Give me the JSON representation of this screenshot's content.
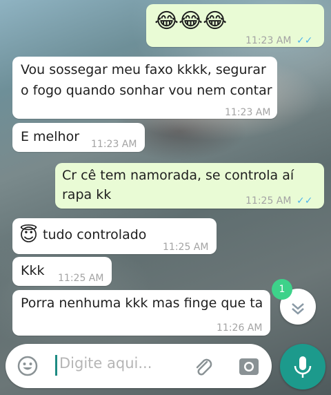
{
  "chat": {
    "messages": [
      {
        "direction": "out",
        "text": "😂😂😂",
        "time": "11:23 AM",
        "ticks": "✓✓"
      },
      {
        "direction": "in",
        "text_line1": "Vou sossegar meu faxo kkkk, segurar",
        "text_line2": "o fogo quando sonhar vou nem contar",
        "time": "11:23 AM"
      },
      {
        "direction": "in",
        "text": "E melhor",
        "time": "11:23 AM"
      },
      {
        "direction": "out",
        "text_line1": "Cr cê tem namorada, se controla aí",
        "text_line2": "rapa kk",
        "time": "11:25 AM",
        "ticks": "✓✓"
      },
      {
        "direction": "in",
        "emoji": "😇",
        "text": "tudo controlado",
        "time": "11:25 AM"
      },
      {
        "direction": "in",
        "text": "Kkk",
        "time": "11:25 AM"
      },
      {
        "direction": "in",
        "text": "Porra nenhuma kkk mas finge que ta",
        "time": "11:26 AM"
      }
    ]
  },
  "scroll_down": {
    "unread_count": "1"
  },
  "composer": {
    "placeholder": "Digite aqui..."
  },
  "colors": {
    "incoming_bubble": "#ffffff",
    "outgoing_bubble": "#e9fbd5",
    "accent": "#1c9a8c",
    "read_ticks": "#4fb6ec",
    "badge": "#3dd28a"
  },
  "icons": {
    "emoji": "emoji-icon",
    "attach": "paperclip-icon",
    "camera": "camera-icon",
    "mic": "microphone-icon",
    "scroll": "chevron-down-icon"
  }
}
